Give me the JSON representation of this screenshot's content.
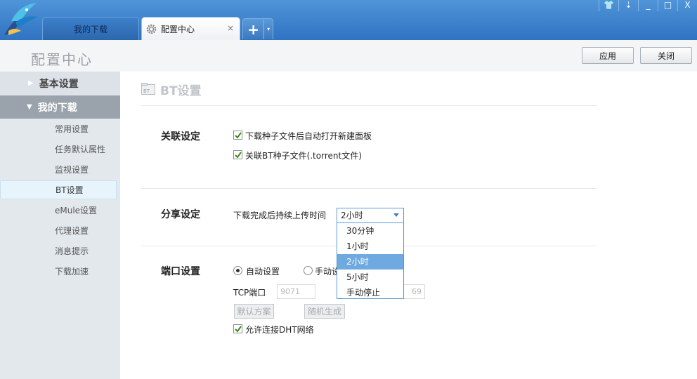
{
  "tabs": {
    "my_downloads": "我的下载",
    "config_center": "配置中心",
    "close_glyph": "×",
    "add_glyph": "+",
    "dropdown_glyph": "▾"
  },
  "window_controls": [
    "skin",
    "menu",
    "minimize",
    "maximize",
    "close"
  ],
  "window_glyphs": {
    "skin": "👕",
    "menu": "⇣",
    "minimize": "_",
    "maximize": "□",
    "close": "X"
  },
  "header": {
    "title": "配置中心",
    "apply_label": "应用",
    "close_label": "关闭"
  },
  "sidebar": {
    "groups": [
      {
        "label": "基本设置",
        "expanded": false
      },
      {
        "label": "我的下载",
        "expanded": true
      }
    ],
    "items": [
      {
        "label": "常用设置"
      },
      {
        "label": "任务默认属性"
      },
      {
        "label": "监视设置"
      },
      {
        "label": "BT设置",
        "active": true
      },
      {
        "label": "eMule设置"
      },
      {
        "label": "代理设置"
      },
      {
        "label": "消息提示"
      },
      {
        "label": "下载加速"
      }
    ]
  },
  "section": {
    "title": "BT设置",
    "icon_text": "BT",
    "association": {
      "label": "关联设定",
      "opt1": "下载种子文件后自动打开新建面板",
      "opt1_checked": true,
      "opt2": "关联BT种子文件(.torrent文件)",
      "opt2_checked": true
    },
    "sharing": {
      "label": "分享设定",
      "upload_label": "下载完成后持续上传时间",
      "selected": "2小时",
      "options": [
        "30分钟",
        "1小时",
        "2小时",
        "5小时",
        "手动停止"
      ]
    },
    "port": {
      "label": "端口设置",
      "auto_label": "自动设置",
      "manual_label": "手动设",
      "auto_selected": true,
      "tcp_label": "TCP端口",
      "tcp_value": "9071",
      "udp_value_partial": "69",
      "default_btn": "默认方案",
      "random_btn": "随机生成",
      "dht_label": "允许连接DHT网络",
      "dht_checked": true
    }
  },
  "colors": {
    "titlebar": "#2f73c2",
    "sidebar_bg": "#e3e8ed",
    "sidebar_expanded": "#9aa2ab",
    "active_item_bg": "#e8f4fb",
    "dropdown_selected": "#6ea9e0"
  }
}
